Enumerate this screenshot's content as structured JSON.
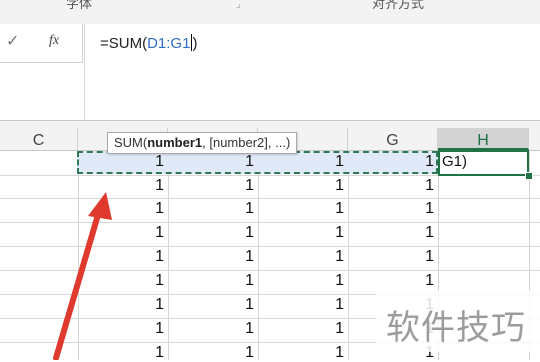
{
  "ribbon": {
    "group_left": "字体",
    "group_right": "对齐方式"
  },
  "formula_bar": {
    "cancel_glyph": "✓",
    "fx_label": "fx",
    "prefix": "=SUM(",
    "ref": "D1:G1",
    "suffix": ")"
  },
  "tooltip": {
    "fn": "SUM(",
    "arg_bold": "number1",
    "rest": ", [number2], ...)"
  },
  "columns": [
    {
      "label": "C"
    },
    {
      "label": ""
    },
    {
      "label": ""
    },
    {
      "label": ""
    },
    {
      "label": "G"
    },
    {
      "label": "H"
    }
  ],
  "active_cell_text": "G1)",
  "cell_value": "1",
  "watermark": "软件技巧",
  "colors": {
    "accent_green": "#217346",
    "reference_blue": "#2f6fc7",
    "arrow_red": "#e03a2f"
  }
}
